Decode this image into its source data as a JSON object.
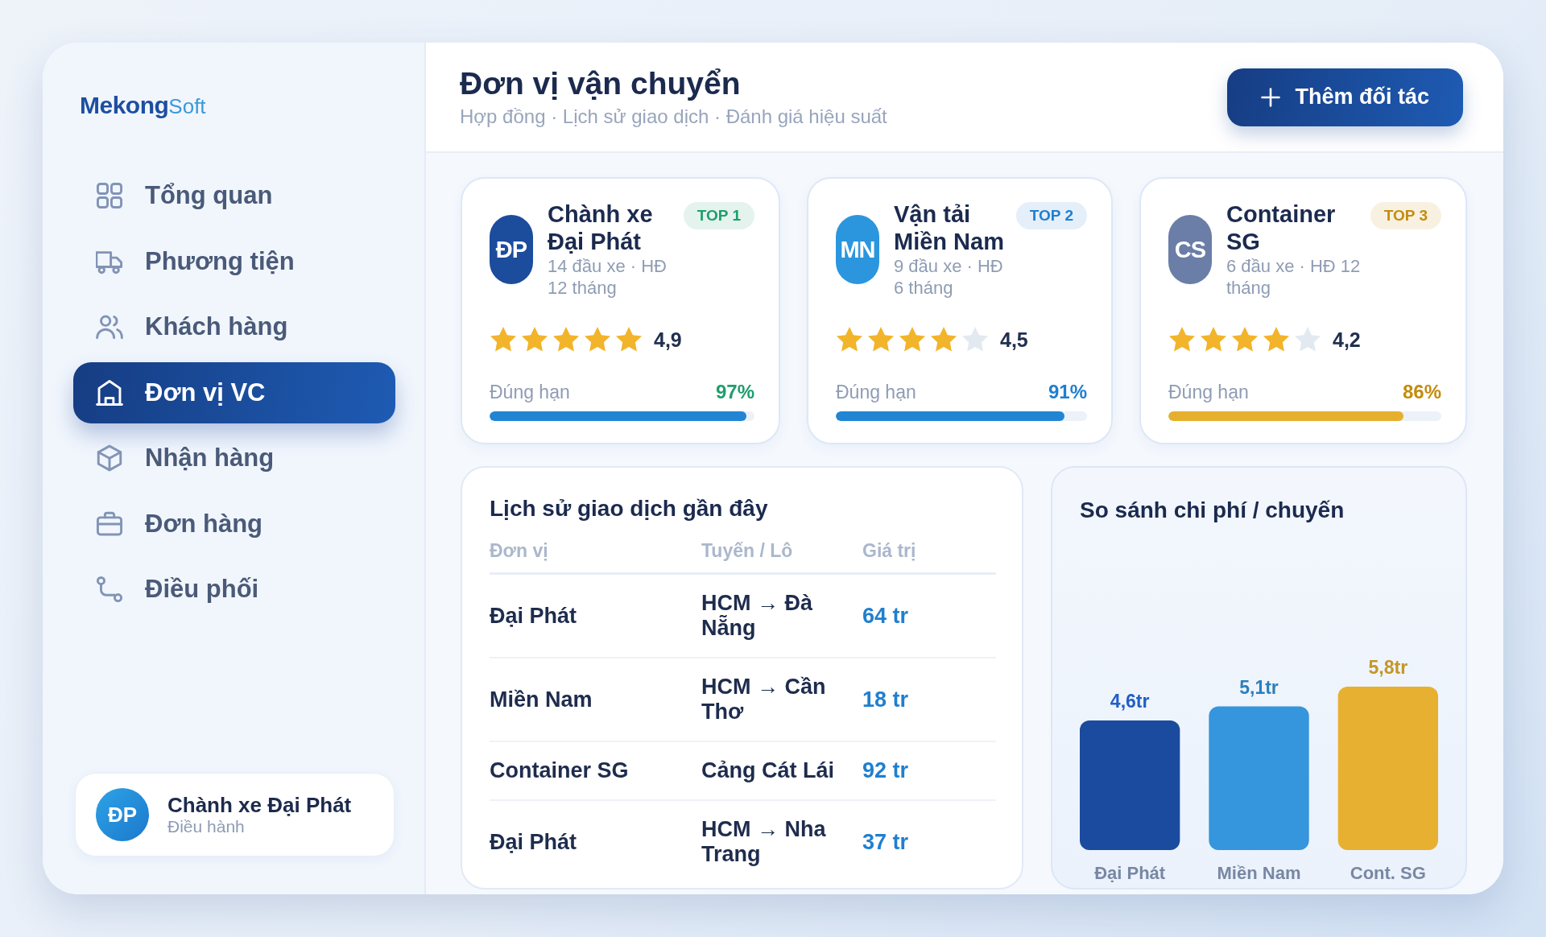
{
  "sidebar": {
    "logo": {
      "primary": "Mekong",
      "secondary": "Soft"
    },
    "nav_items": [
      {
        "label": "Tổng quan",
        "selected": false
      },
      {
        "label": "Phương tiện",
        "selected": false
      },
      {
        "label": "Khách hàng",
        "selected": false
      },
      {
        "label": "Đơn vị VC",
        "selected": true
      },
      {
        "label": "Nhận hàng",
        "selected": false
      },
      {
        "label": "Đơn hàng",
        "selected": false
      },
      {
        "label": "Điều phối",
        "selected": false
      }
    ],
    "user": {
      "initials": "ĐP",
      "name": "Chành xe Đại Phát",
      "role": "Điều hành"
    }
  },
  "header": {
    "title": "Đơn vị vận chuyển",
    "subtitle": "Hợp đồng · Lịch sử giao dịch · Đánh giá hiệu suất",
    "button": {
      "label": "Thêm đối tác"
    }
  },
  "partners": [
    {
      "avatar": {
        "initials": "ĐP",
        "color": "#1c4c9c"
      },
      "name": "Chành xe Đại Phát",
      "details": "14 đầu xe · HĐ 12 tháng",
      "badge": "TOP 1",
      "color": "#1e9e6c",
      "stars": 5,
      "rating": "4,9",
      "on_time": {
        "label": "Đúng hạn",
        "value": "97%",
        "level": 0.97,
        "color": "#2185d3"
      }
    },
    {
      "avatar": {
        "initials": "MN",
        "color": "#2b96dd"
      },
      "name": "Vận tải Miền Nam",
      "details": "9 đầu xe · HĐ 6 tháng",
      "badge": "TOP 2",
      "color": "#1f7fcf",
      "stars": 4,
      "rating": "4,5",
      "on_time": {
        "label": "Đúng hạn",
        "value": "91%",
        "level": 0.91,
        "color": "#2185d3"
      }
    },
    {
      "avatar": {
        "initials": "CS",
        "color": "#6a7ea7"
      },
      "name": "Container SG",
      "details": "6 đầu xe · HĐ 12 tháng",
      "badge": "TOP 3",
      "color": "#c48c0e",
      "stars": 4,
      "rating": "4,2",
      "on_time": {
        "label": "Đúng hạn",
        "value": "86%",
        "level": 0.86,
        "color": "#e6b02f"
      }
    }
  ],
  "transactions": {
    "title": "Lịch sử giao dịch gần đây",
    "columns": [
      "Đơn vị",
      "Tuyến / Lô",
      "Giá trị"
    ],
    "rows": [
      {
        "unit": "Đại Phát",
        "route": "HCM → Đà Nẵng",
        "value": "64 tr"
      },
      {
        "unit": "Miền Nam",
        "route": "HCM → Cần Thơ",
        "value": "18 tr"
      },
      {
        "unit": "Container SG",
        "route": "Cảng Cát Lái",
        "value": "92 tr"
      },
      {
        "unit": "Đại Phát",
        "route": "HCM → Nha Trang",
        "value": "37 tr"
      }
    ]
  },
  "cost_comparison": {
    "chart_data": {
      "type": "bar",
      "title": "So sánh chi phí / chuyến",
      "categories": [
        "Đại Phát",
        "Miền Nam",
        "Cont. SG"
      ],
      "series": [
        {
          "values": [
            4.6,
            5.1,
            5.8
          ],
          "colors": [
            "#1b4b9e",
            "#3595dd",
            "#e8b030"
          ],
          "value_labels": [
            "4,6tr",
            "5,1tr",
            "5,8tr"
          ]
        }
      ]
    }
  }
}
